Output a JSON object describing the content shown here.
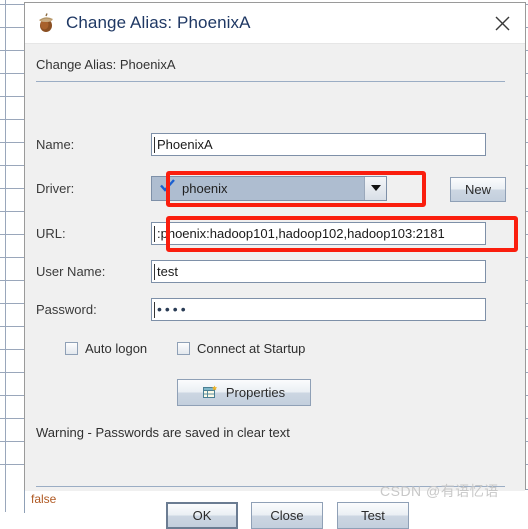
{
  "window": {
    "title": "Change Alias: PhoenixA",
    "app_icon": "acorn-icon",
    "close_label": "✕"
  },
  "dialog": {
    "heading": "Change Alias: PhoenixA",
    "fields": [
      {
        "label": "Name:",
        "value": "PhoenixA"
      },
      {
        "label": "Driver:",
        "value": "phoenix"
      },
      {
        "label": "URL:",
        "value": ":phoenix:hadoop101,hadoop102,hadoop103:2181"
      },
      {
        "label": "User Name:",
        "value": "test"
      },
      {
        "label": "Password:",
        "value": "••••"
      }
    ],
    "new_button": "New",
    "checkboxes": [
      {
        "label": "Auto logon",
        "checked": false
      },
      {
        "label": "Connect at Startup",
        "checked": false
      }
    ],
    "properties_button": "Properties",
    "warning": "Warning - Passwords are saved in clear text",
    "footer_buttons": [
      {
        "label": "OK"
      },
      {
        "label": "Close"
      },
      {
        "label": "Test"
      }
    ]
  },
  "background": {
    "cell_text": "false"
  },
  "watermark": "CSDN @有语忆语",
  "colors": {
    "annotation": "#fa1e0e",
    "title": "#1f3864",
    "combo_selected_bg": "#aebdd0",
    "check_blue": "#1a5fd0",
    "dialog_bg": "#f0f0f0"
  }
}
